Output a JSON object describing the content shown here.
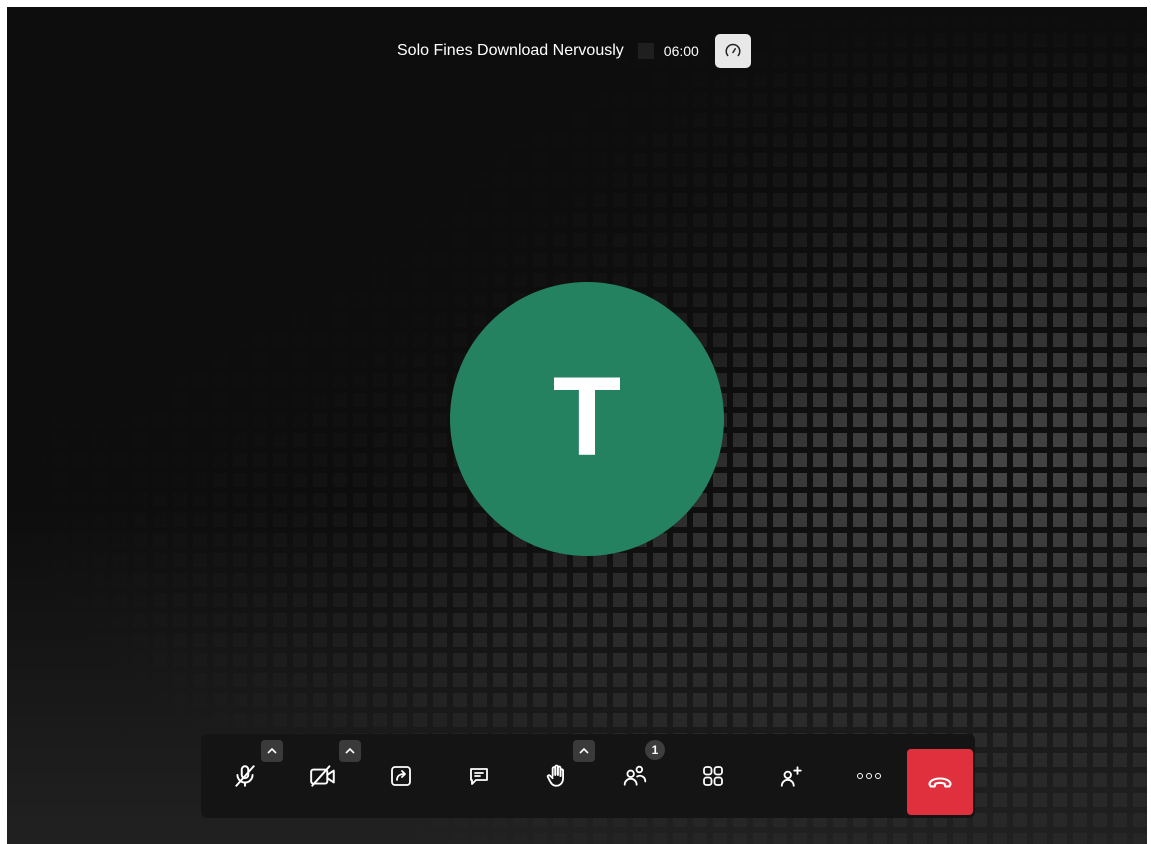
{
  "meeting": {
    "subject": "Solo Fines Download Nervously",
    "timer": "06:00"
  },
  "participant": {
    "initial": "T",
    "avatar_color": "#248261"
  },
  "toolbar": {
    "participants_count": "1",
    "hangup_color": "#e0303d",
    "buttons": [
      {
        "name": "microphone",
        "icon": "microphone-off-icon"
      },
      {
        "name": "camera",
        "icon": "camera-off-icon"
      },
      {
        "name": "share-screen",
        "icon": "share-screen-icon"
      },
      {
        "name": "chat",
        "icon": "chat-icon"
      },
      {
        "name": "raise-hand",
        "icon": "raise-hand-icon"
      },
      {
        "name": "participants",
        "icon": "participants-icon"
      },
      {
        "name": "tile-view",
        "icon": "tile-view-icon"
      },
      {
        "name": "invite",
        "icon": "add-participant-icon"
      },
      {
        "name": "more",
        "icon": "more-icon"
      },
      {
        "name": "hangup",
        "icon": "hangup-icon"
      }
    ]
  }
}
